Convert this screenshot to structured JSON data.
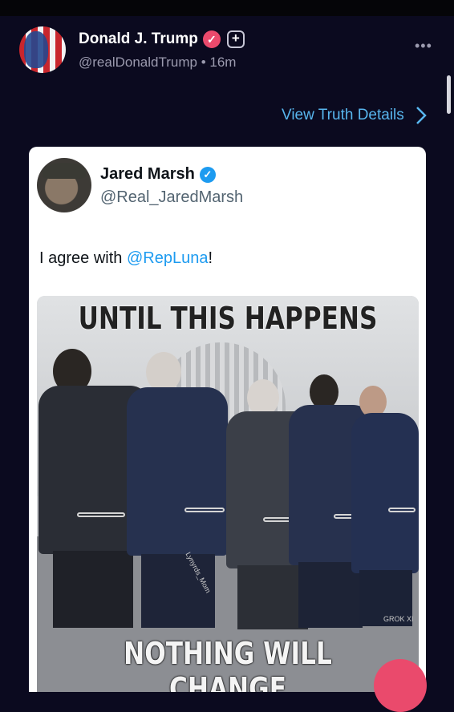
{
  "post": {
    "author_name": "Donald J. Trump",
    "handle": "@realDonaldTrump",
    "separator": "•",
    "time": "16m",
    "follow_label": "+",
    "more_label": "•••",
    "view_details_label": "View Truth Details"
  },
  "quoted_tweet": {
    "author_name": "Jared Marsh",
    "handle": "@Real_JaredMarsh",
    "text_before": "I agree with ",
    "mention": "@RepLuna",
    "text_after": "!"
  },
  "meme": {
    "top_caption": "UNTIL THIS HAPPENS",
    "bottom_caption": "NOTHING WILL CHANGE",
    "watermark": "Lynyrds_Mom",
    "corner_mark": "GROK XI"
  },
  "colors": {
    "background": "#0b0a1f",
    "accent_link": "#58b6ee",
    "truth_badge": "#ea4a6c",
    "x_badge": "#1d9bf0"
  },
  "icons": {
    "verified": "check-badge-icon",
    "follow": "plus-square-icon",
    "more": "ellipsis-icon",
    "chevron": "chevron-right-icon"
  }
}
